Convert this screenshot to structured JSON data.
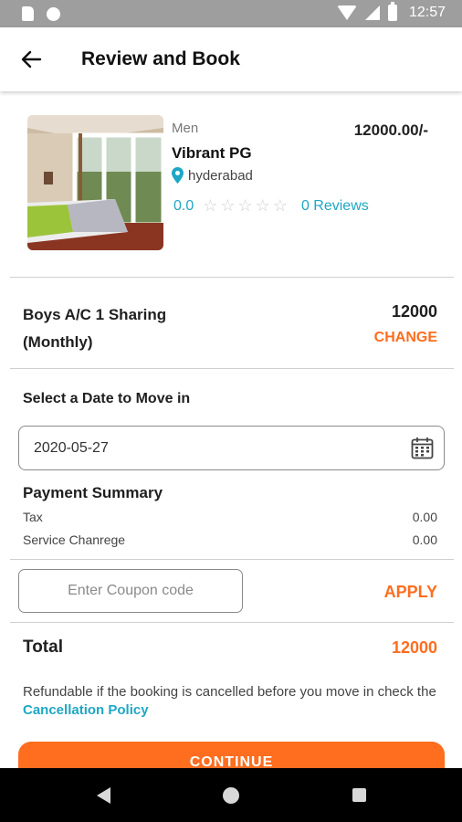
{
  "status_bar": {
    "time": "12:57"
  },
  "header": {
    "title": "Review and Book"
  },
  "property": {
    "category": "Men",
    "name": "Vibrant PG",
    "price": "12000.00/-",
    "location": "hyderabad",
    "rating": "0.0",
    "reviews": "0 Reviews",
    "stars_filled": 0,
    "stars_total": 5
  },
  "room": {
    "name_line1": "Boys A/C 1 Sharing",
    "name_line2": "(Monthly)",
    "price": "12000",
    "change_label": "CHANGE"
  },
  "date": {
    "label": "Select a Date to Move in",
    "value": "2020-05-27"
  },
  "payment_summary": {
    "title": "Payment Summary",
    "rows": [
      {
        "label": "Tax",
        "value": "0.00"
      },
      {
        "label": "Service Chanrege",
        "value": "0.00"
      }
    ]
  },
  "coupon": {
    "placeholder": "Enter Coupon code",
    "apply_label": "APPLY"
  },
  "total": {
    "label": "Total",
    "value": "12000"
  },
  "refund": {
    "text": "Refundable if the booking is cancelled before you move in check the ",
    "link": "Cancellation Policy"
  },
  "continue_label": "CONTINUE",
  "colors": {
    "accent": "#ff6d1f",
    "link": "#1ea7c4"
  }
}
